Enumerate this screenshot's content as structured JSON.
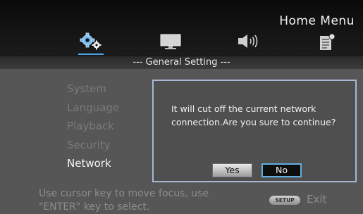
{
  "header": {
    "title": "Home Menu",
    "tabs": [
      {
        "icon": "gear-icon",
        "selected": true
      },
      {
        "icon": "monitor-icon",
        "selected": false
      },
      {
        "icon": "speaker-icon",
        "selected": false
      },
      {
        "icon": "document-icon",
        "selected": false
      }
    ]
  },
  "section": {
    "title": "--- General Setting ---"
  },
  "menu": {
    "items": [
      {
        "label": "System",
        "active": false
      },
      {
        "label": "Language",
        "active": false
      },
      {
        "label": "Playback",
        "active": false
      },
      {
        "label": "Security",
        "active": false
      },
      {
        "label": "Network",
        "active": true
      }
    ]
  },
  "dialog": {
    "message": "It will cut off the current network connection.Are you sure to continue?",
    "yes_label": "Yes",
    "no_label": "No",
    "focused": "No"
  },
  "footer": {
    "hint": "Use cursor key to move focus, use \"ENTER\" key to select.",
    "setup_label": "SETUP",
    "exit_label": "Exit"
  },
  "colors": {
    "background": "#565656",
    "accent": "#4aa6e8",
    "dialog_border": "#a8b8d3"
  }
}
